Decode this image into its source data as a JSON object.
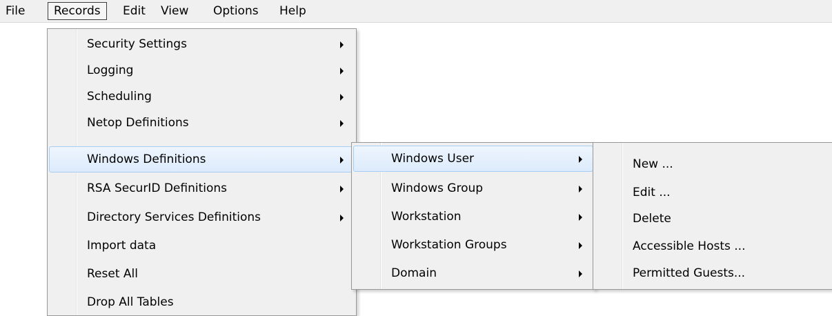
{
  "menubar": {
    "items": [
      {
        "label": "File"
      },
      {
        "label": "Records"
      },
      {
        "label": "Edit"
      },
      {
        "label": "View"
      },
      {
        "label": "Options"
      },
      {
        "label": "Help"
      }
    ]
  },
  "records_menu": {
    "items": [
      {
        "label": "Security Settings",
        "submenu": true
      },
      {
        "label": "Logging",
        "submenu": true
      },
      {
        "label": "Scheduling",
        "submenu": true
      },
      {
        "label": "Netop Definitions",
        "submenu": true
      },
      {
        "label": "Windows Definitions",
        "submenu": true,
        "highlighted": true
      },
      {
        "label": "RSA SecurID Definitions",
        "submenu": true
      },
      {
        "label": "Directory Services Definitions",
        "submenu": true
      },
      {
        "label": "Import data",
        "submenu": false
      },
      {
        "label": "Reset All",
        "submenu": false
      },
      {
        "label": "Drop All Tables",
        "submenu": false
      }
    ]
  },
  "windows_definitions_menu": {
    "items": [
      {
        "label": "Windows User",
        "submenu": true,
        "highlighted": true
      },
      {
        "label": "Windows Group",
        "submenu": true
      },
      {
        "label": "Workstation",
        "submenu": true
      },
      {
        "label": "Workstation Groups",
        "submenu": true
      },
      {
        "label": "Domain",
        "submenu": true
      }
    ]
  },
  "windows_user_menu": {
    "items": [
      {
        "label": "New ...",
        "submenu": false
      },
      {
        "label": "Edit ...",
        "submenu": false
      },
      {
        "label": "Delete",
        "submenu": false
      },
      {
        "label": "Accessible Hosts ...",
        "submenu": false
      },
      {
        "label": "Permitted Guests...",
        "submenu": false
      }
    ]
  },
  "colors": {
    "menu_background": "#f0f0f0",
    "highlight_background": "#dcebfc",
    "highlight_border": "#a8cdf3",
    "menu_border": "#979797"
  }
}
